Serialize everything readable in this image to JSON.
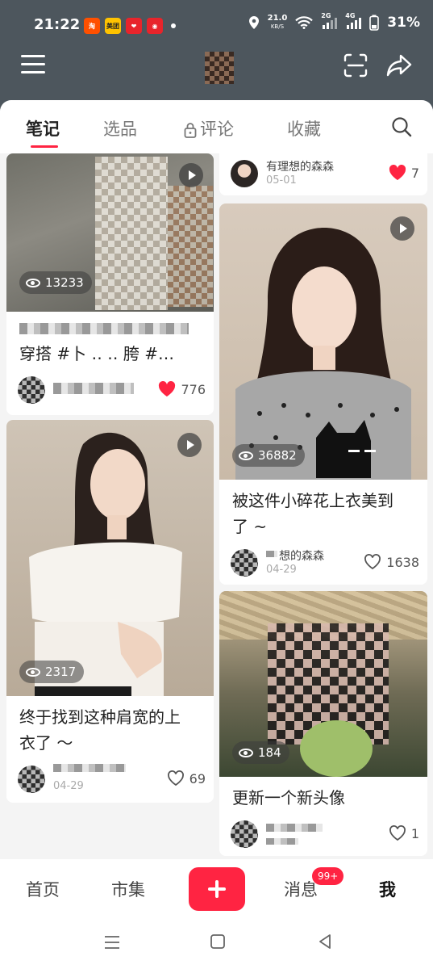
{
  "status": {
    "time": "21:22",
    "apps": [
      {
        "name": "taobao-icon",
        "label": "淘",
        "color": "#ff5000"
      },
      {
        "name": "meituan-icon",
        "label": "美团",
        "color": "#ffc300"
      },
      {
        "name": "heart-app-icon",
        "label": "❤",
        "color": "#e8242b"
      },
      {
        "name": "robot-app-icon",
        "label": "◉",
        "color": "#e8242b"
      }
    ],
    "net_speed": "21.0",
    "net_unit": "KB/S",
    "signal_2g": "2G",
    "signal_4g": "4G",
    "battery": "31%"
  },
  "tabs": {
    "notes": "笔记",
    "picks": "选品",
    "comments": "评论",
    "favorites": "收藏"
  },
  "left_column": [
    {
      "has_play": true,
      "views": "13233",
      "title_line1": "",
      "title_line2": "穿搭 #卜  ‥ ‥ 胯 #…",
      "author": "",
      "date": "",
      "likes": "776",
      "liked": true
    },
    {
      "has_play": true,
      "views": "2317",
      "title_line1": "终于找到这种肩宽的上",
      "title_line2": "衣了 ～",
      "author": "",
      "date": "04-29",
      "likes": "69",
      "liked": false
    }
  ],
  "right_column": [
    {
      "author": "有理想的森森",
      "date": "05-01",
      "likes": "7",
      "liked": true
    },
    {
      "has_play": true,
      "views": "36882",
      "title_line1": "被这件小碎花上衣美到",
      "title_line2": "了 ~",
      "author": "想的森森",
      "date": "04-29",
      "likes": "1638",
      "liked": false
    },
    {
      "has_play": false,
      "views": "184",
      "title_line1": "更新一个新头像",
      "title_line2": "",
      "author": "",
      "date": "",
      "likes": "1",
      "liked": false
    }
  ],
  "bottom_nav": {
    "home": "首页",
    "market": "市集",
    "messages": "消息",
    "messages_badge": "99+",
    "me": "我"
  },
  "colors": {
    "brand": "#ff2442",
    "header_bg": "#4d565d"
  }
}
